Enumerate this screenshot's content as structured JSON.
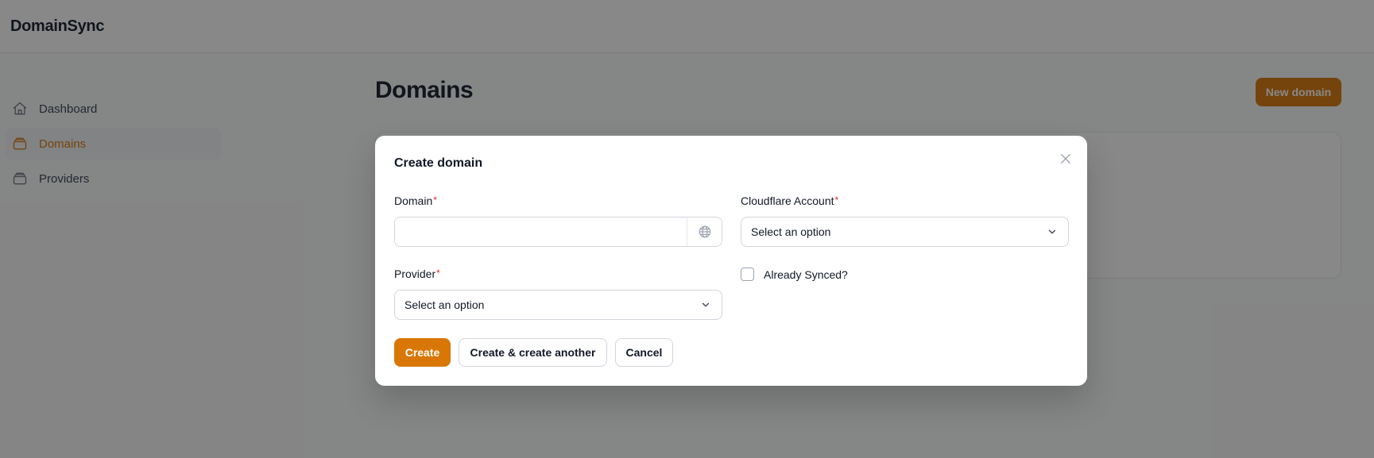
{
  "app": {
    "brand": "DomainSync"
  },
  "sidebar": {
    "items": [
      {
        "label": "Dashboard",
        "icon": "home-icon",
        "active": false
      },
      {
        "label": "Domains",
        "icon": "stack-icon",
        "active": true
      },
      {
        "label": "Providers",
        "icon": "stack-icon",
        "active": false
      }
    ]
  },
  "page": {
    "title": "Domains",
    "new_button": "New domain"
  },
  "modal": {
    "title": "Create domain",
    "fields": {
      "domain": {
        "label": "Domain",
        "required": "*",
        "value": "",
        "suffix_icon": "globe-icon"
      },
      "cloudflare": {
        "label": "Cloudflare Account",
        "required": "*",
        "value": "Select an option"
      },
      "provider": {
        "label": "Provider",
        "required": "*",
        "value": "Select an option"
      },
      "synced": {
        "label": "Already Synced?",
        "checked": false
      }
    },
    "buttons": {
      "create": "Create",
      "create_another": "Create & create another",
      "cancel": "Cancel"
    }
  },
  "colors": {
    "accent": "#d97706",
    "required": "#dc2626",
    "overlay": "rgba(17,17,17,0.5)"
  }
}
